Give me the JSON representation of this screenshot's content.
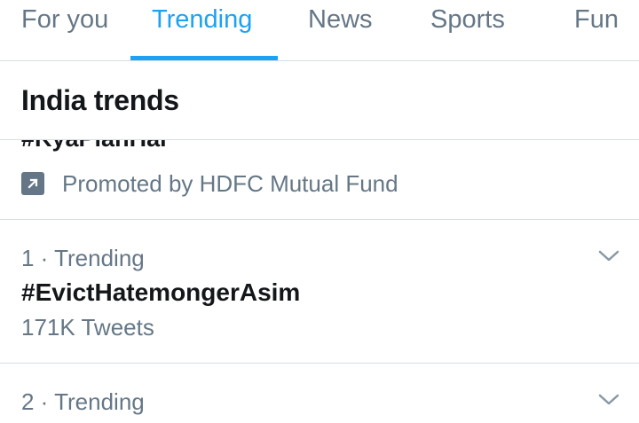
{
  "tabs": [
    {
      "label": "For you",
      "active": false
    },
    {
      "label": "Trending",
      "active": true
    },
    {
      "label": "News",
      "active": false
    },
    {
      "label": "Sports",
      "active": false
    },
    {
      "label": "Fun",
      "active": false
    }
  ],
  "section": {
    "title": "India trends"
  },
  "promoted": {
    "hashtag": "#KyaPlanHai",
    "label": "Promoted by HDFC Mutual Fund",
    "icon": "promoted-arrow-icon"
  },
  "trends": [
    {
      "meta": "1 · Trending",
      "name": "#EvictHatemongerAsim",
      "count": "171K Tweets",
      "icon": "chevron-down-icon"
    },
    {
      "meta": "2 · Trending",
      "icon": "chevron-down-icon"
    }
  ],
  "colors": {
    "accent": "#1da1f2",
    "muted": "#657786",
    "text": "#14171a",
    "divider": "#d8dee3"
  }
}
